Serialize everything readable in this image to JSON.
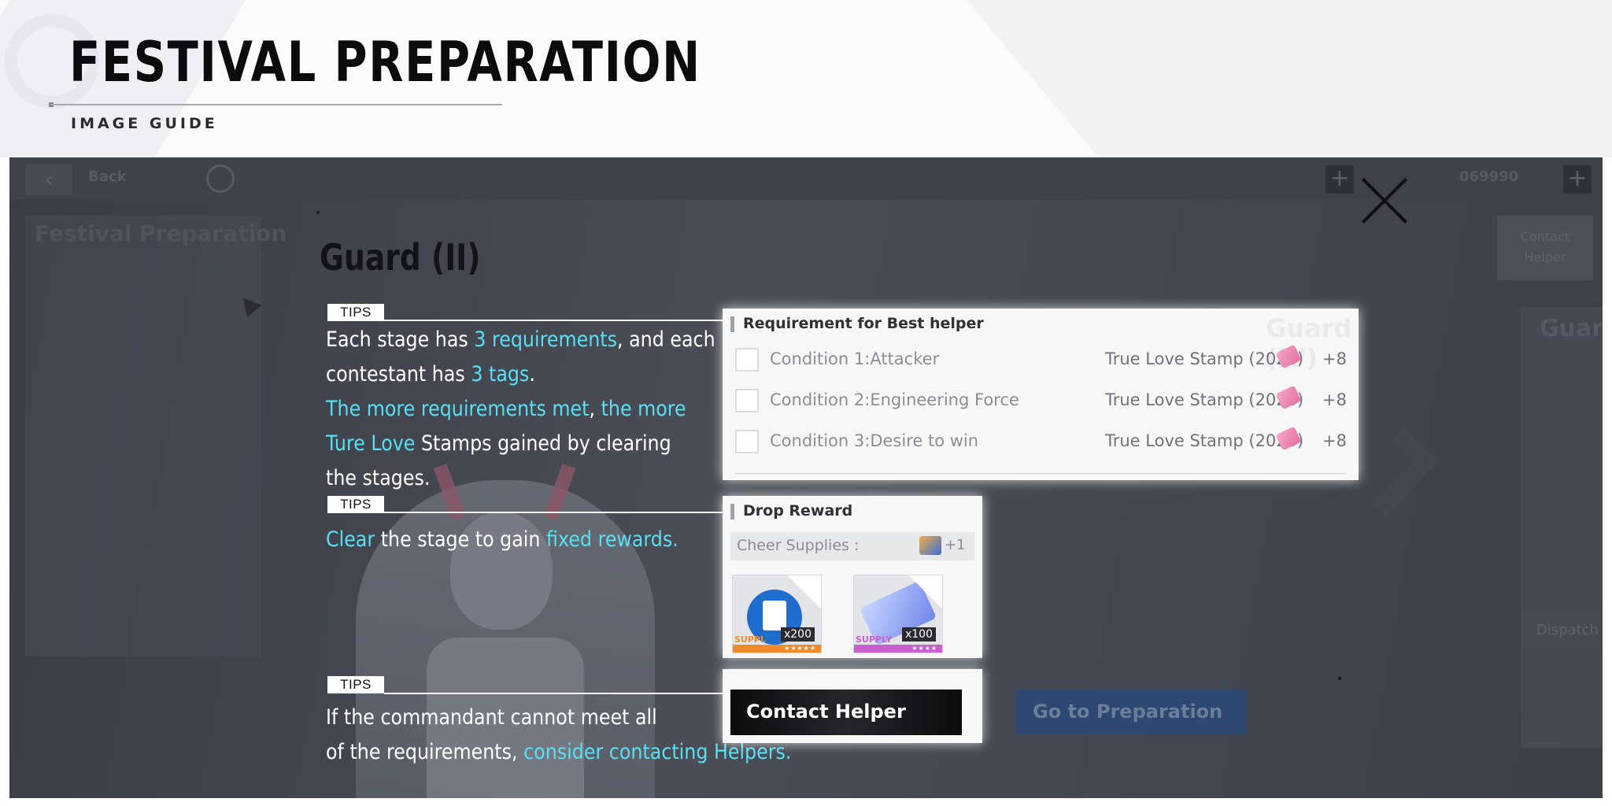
{
  "header": {
    "title": "FESTIVAL PREPARATION",
    "subtitle": "IMAGE GUIDE"
  },
  "background_ui": {
    "left_title": "Festival Preparation",
    "contact_tile": [
      "Contact",
      "Helper"
    ],
    "right_title": "Guard",
    "dispatch_label": "Dispatch",
    "top_counter": "069990"
  },
  "stage": {
    "title": "Guard (II)"
  },
  "tips": [
    {
      "label": "TIPS",
      "lines": [
        [
          {
            "t": "Each stage has ",
            "hl": false
          },
          {
            "t": "3 requirements",
            "hl": true
          },
          {
            "t": ", and each",
            "hl": false
          }
        ],
        [
          {
            "t": "contestant has ",
            "hl": false
          },
          {
            "t": "3 tags",
            "hl": true
          },
          {
            "t": ".",
            "hl": false
          }
        ],
        [
          {
            "t": "The more requirements met",
            "hl": true
          },
          {
            "t": ", ",
            "hl": false
          },
          {
            "t": "the more",
            "hl": true
          }
        ],
        [
          {
            "t": "Ture Love",
            "hl": true
          },
          {
            "t": " Stamps gained by clearing",
            "hl": false
          }
        ],
        [
          {
            "t": "the stages.",
            "hl": false
          }
        ]
      ]
    },
    {
      "label": "TIPS",
      "lines": [
        [
          {
            "t": "Clear",
            "hl": true
          },
          {
            "t": " the stage to gain ",
            "hl": false
          },
          {
            "t": "fixed rewards.",
            "hl": true
          }
        ]
      ]
    },
    {
      "label": "TIPS",
      "lines": [
        [
          {
            "t": "If the commandant cannot meet all",
            "hl": false
          }
        ],
        [
          {
            "t": "of the requirements, ",
            "hl": false
          },
          {
            "t": "consider contacting Helpers.",
            "hl": true
          }
        ]
      ]
    }
  ],
  "requirements": {
    "header": "Requirement for Best helper",
    "ghost_text": "Guard (IV)",
    "rows": [
      {
        "condition": "Condition 1:Attacker",
        "reward": "True Love Stamp (2023)",
        "amount": "+8"
      },
      {
        "condition": "Condition 2:Engineering Force",
        "reward": "True Love Stamp (2023)",
        "amount": "+8"
      },
      {
        "condition": "Condition 3:Desire to win",
        "reward": "True Love Stamp (2023)",
        "amount": "+8"
      }
    ]
  },
  "drop": {
    "header": "Drop Reward",
    "cheer_label": "Cheer Supplies :",
    "cheer_amount": "+1",
    "items": [
      {
        "qty": "x200",
        "tag": "SUPPL",
        "strip_color": "#f08a2a",
        "stars": "★★★★★"
      },
      {
        "qty": "x100",
        "tag": "SUPPLY",
        "strip_color": "#c85fcf",
        "stars": "★★★★"
      }
    ]
  },
  "buttons": {
    "contact_helper": "Contact Helper",
    "go_to_preparation": "Go to Preparation"
  },
  "colors": {
    "highlight": "#58dff1",
    "overlay": "#3a3d45",
    "go_button": "#2e4872"
  }
}
